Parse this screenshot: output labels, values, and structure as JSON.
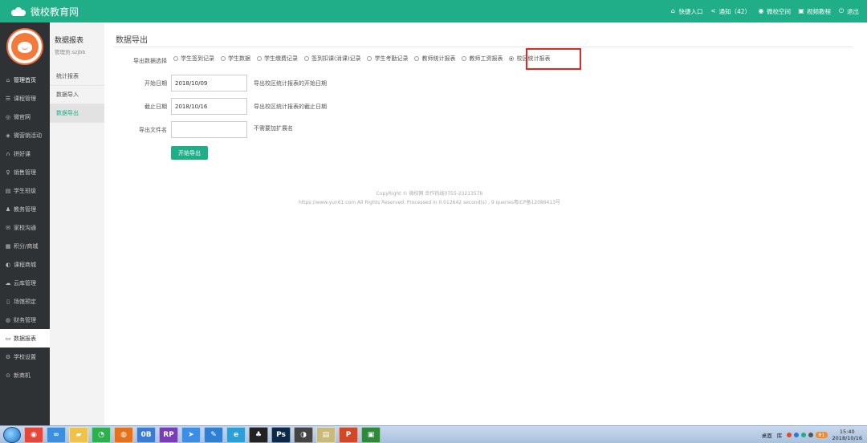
{
  "header": {
    "brand": "微校教育网",
    "links": [
      {
        "icon": "home-icon",
        "glyph": "⌂",
        "label": "快捷入口"
      },
      {
        "icon": "share-icon",
        "glyph": "<",
        "label": "通知（42）"
      },
      {
        "icon": "eye-icon",
        "glyph": "◉",
        "label": "微校空间"
      },
      {
        "icon": "tutorial-icon",
        "glyph": "▣",
        "label": "视频教程"
      },
      {
        "icon": "power-icon",
        "glyph": "⏻",
        "label": "退出"
      }
    ]
  },
  "sidebar": {
    "items": [
      {
        "icon": "home-icon",
        "glyph": "⌂",
        "label": "管理首页"
      },
      {
        "icon": "course-icon",
        "glyph": "☰",
        "label": "课程管理"
      },
      {
        "icon": "micro-site-icon",
        "glyph": "◎",
        "label": "微官网"
      },
      {
        "icon": "marketing-icon",
        "glyph": "◈",
        "label": "微营销活动"
      },
      {
        "icon": "group-course-icon",
        "glyph": "∩",
        "label": "拼好课"
      },
      {
        "icon": "sales-icon",
        "glyph": "♀",
        "label": "销售管理"
      },
      {
        "icon": "class-icon",
        "glyph": "▤",
        "label": "学生班级"
      },
      {
        "icon": "teaching-icon",
        "glyph": "♟",
        "label": "教务管理"
      },
      {
        "icon": "home-school-icon",
        "glyph": "✉",
        "label": "家校沟通"
      },
      {
        "icon": "points-mall-icon",
        "glyph": "▦",
        "label": "积分/商城"
      },
      {
        "icon": "course-mall-icon",
        "glyph": "◐",
        "label": "课程商城"
      },
      {
        "icon": "cloud-icon",
        "glyph": "☁",
        "label": "云库管理"
      },
      {
        "icon": "venue-icon",
        "glyph": "▯",
        "label": "场馆预定"
      },
      {
        "icon": "finance-icon",
        "glyph": "◍",
        "label": "财务管理"
      },
      {
        "icon": "report-icon",
        "glyph": "▭",
        "label": "数据报表"
      },
      {
        "icon": "settings-icon",
        "glyph": "⚙",
        "label": "学校设置"
      },
      {
        "icon": "new-machine-icon",
        "glyph": "⊙",
        "label": "新商机"
      }
    ],
    "active_index": 14
  },
  "subside": {
    "title": "数据报表",
    "admin": "管理员:szjbb",
    "items": [
      "统计报表",
      "数据导入",
      "数据导出"
    ],
    "active_index": 2
  },
  "main": {
    "title": "数据导出",
    "type_label": "导出数据选择",
    "options": [
      "学生签到记录",
      "学生数据",
      "学生缴费记录",
      "签到扣课(消课)记录",
      "学生考勤记录",
      "教师统计报表",
      "教师工资报表",
      "校区统计报表"
    ],
    "selected_index": 7,
    "start_label": "开始日期",
    "start_value": "2018/10/09",
    "start_hint": "导出校区统计报表的开始日期",
    "end_label": "截止日期",
    "end_value": "2018/10/16",
    "end_hint": "导出校区统计报表的截止日期",
    "filename_label": "导出文件名",
    "filename_value": "",
    "filename_hint": "不需要加扩展名",
    "export_button": "开始导出",
    "footer_line1": "CopyRight © 微校网 合作热线0755-23213576",
    "footer_line2": "https://www.yun61.com All Rights Reserved. Processed in 0.012642 second(s) , 9 queries粤ICP备12086413号"
  },
  "taskbar": {
    "apps": [
      {
        "name": "chrome-icon",
        "color": "#e9463a",
        "glyph": "◉"
      },
      {
        "name": "baidu-netdisk-icon",
        "color": "#3b8fe0",
        "glyph": "∞"
      },
      {
        "name": "folder-icon",
        "color": "#f0c24a",
        "glyph": "▰"
      },
      {
        "name": "wechat-icon",
        "color": "#2bb24c",
        "glyph": "◔"
      },
      {
        "name": "firefox-icon",
        "color": "#e8701a",
        "glyph": "◍"
      },
      {
        "name": "onenote-icon",
        "color": "#3a7bd5",
        "glyph": "0B"
      },
      {
        "name": "axure-icon",
        "color": "#7a3db8",
        "glyph": "RP"
      },
      {
        "name": "paper-plane-icon",
        "color": "#3a8ee6",
        "glyph": "➤"
      },
      {
        "name": "pen-icon",
        "color": "#2f7fd6",
        "glyph": "✎"
      },
      {
        "name": "ie-icon",
        "color": "#2a9fd8",
        "glyph": "e"
      },
      {
        "name": "qq-icon",
        "color": "#222222",
        "glyph": "♣"
      },
      {
        "name": "photoshop-icon",
        "color": "#0b2a4a",
        "glyph": "Ps"
      },
      {
        "name": "media-icon",
        "color": "#444444",
        "glyph": "◑"
      },
      {
        "name": "notepad-icon",
        "color": "#c9b97a",
        "glyph": "▤"
      },
      {
        "name": "powerpoint-icon",
        "color": "#d24726",
        "glyph": "P"
      },
      {
        "name": "green-app-icon",
        "color": "#2d8a3a",
        "glyph": "▣"
      }
    ],
    "tray_labels": [
      "桌面",
      "库"
    ],
    "badge": "81",
    "time": "15:40",
    "date": "2018/10/16"
  }
}
